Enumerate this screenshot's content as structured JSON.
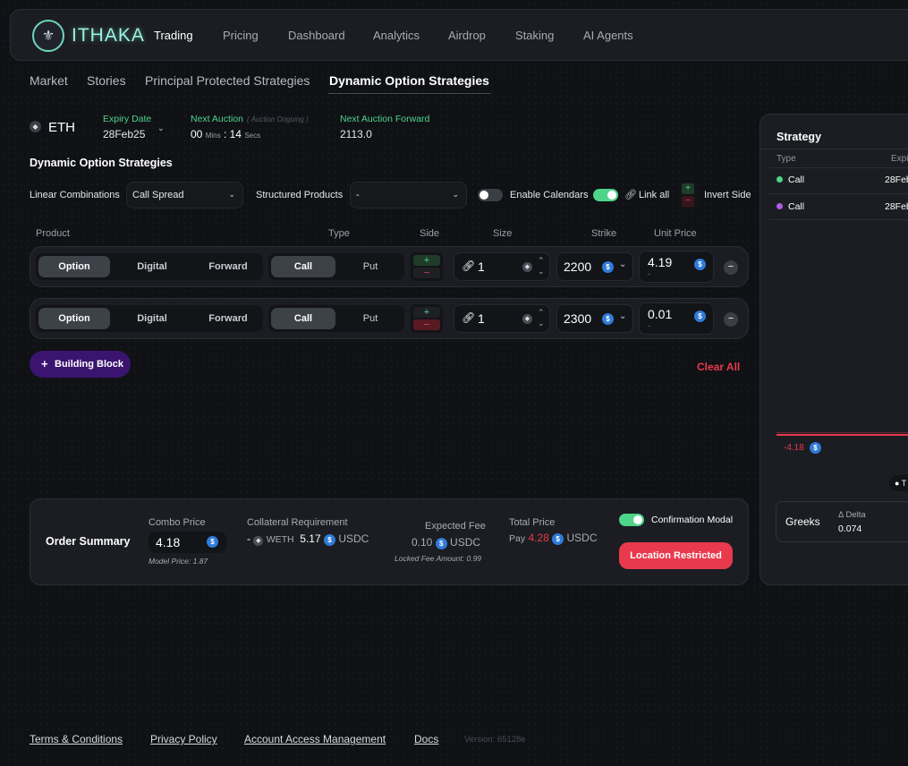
{
  "nav": {
    "logo_text": "ITHAKA",
    "items": [
      {
        "label": "Trading"
      },
      {
        "label": "Pricing"
      },
      {
        "label": "Dashboard"
      },
      {
        "label": "Analytics"
      },
      {
        "label": "Airdrop"
      },
      {
        "label": "Staking"
      },
      {
        "label": "AI Agents"
      }
    ]
  },
  "subtabs": [
    {
      "label": "Market"
    },
    {
      "label": "Stories"
    },
    {
      "label": "Principal Protected Strategies"
    },
    {
      "label": "Dynamic Option Strategies"
    }
  ],
  "asset": {
    "symbol": "ETH",
    "icon": "eth-icon"
  },
  "expiry": {
    "label": "Expiry Date",
    "value": "28Feb25"
  },
  "auction": {
    "label": "Next Auction",
    "status": "( Auction Ongoing )",
    "mins": "00",
    "mins_unit": "Mins",
    "sep": ":",
    "secs": "14",
    "secs_unit": "Secs"
  },
  "forward": {
    "label": "Next Auction Forward",
    "value": "2113.0"
  },
  "builder": {
    "title": "Dynamic Option Strategies",
    "linear_label": "Linear Combinations",
    "linear_value": "Call Spread",
    "structured_label": "Structured Products",
    "structured_value": "-",
    "enable_calendars": "Enable Calendars",
    "link_all": "Link all",
    "invert_side": "Invert Side"
  },
  "headers": {
    "product": "Product",
    "type": "Type",
    "side": "Side",
    "size": "Size",
    "strike": "Strike",
    "unit_price": "Unit Price"
  },
  "legs": [
    {
      "products": [
        "Option",
        "Digital",
        "Forward"
      ],
      "types": [
        "Call",
        "Put"
      ],
      "plus": "+",
      "minus": "−",
      "size": "1",
      "strike": "2200",
      "unit_price": "4.19",
      "sub": "-",
      "side": "buy"
    },
    {
      "products": [
        "Option",
        "Digital",
        "Forward"
      ],
      "types": [
        "Call",
        "Put"
      ],
      "plus": "+",
      "minus": "−",
      "size": "1",
      "strike": "2300",
      "unit_price": "0.01",
      "sub": "-",
      "side": "sell"
    }
  ],
  "building_block": "Building Block",
  "clear_all": "Clear All",
  "order": {
    "title": "Order Summary",
    "combo_label": "Combo Price",
    "combo_value": "4.18",
    "model_price": "Model Price: 1.87",
    "collateral_label": "Collateral Requirement",
    "collateral_dash": "-",
    "collateral_weth": "WETH",
    "collateral_value": "5.17",
    "collateral_unit": "USDC",
    "fee_label": "Expected Fee",
    "fee_value": "0.10",
    "fee_unit": "USDC",
    "locked_fee": "Locked Fee Amount: 0.99",
    "total_label": "Total Price",
    "pay_label": "Pay",
    "pay_value": "4.28",
    "pay_unit": "USDC",
    "confirm_label": "Confirmation Modal",
    "location_btn": "Location Restricted"
  },
  "strategy": {
    "title": "Strategy",
    "type_header": "Type",
    "exp_header": "Expi",
    "rows": [
      {
        "type": "Call",
        "exp": "28Feb",
        "color": "#4ed58a"
      },
      {
        "type": "Call",
        "exp": "28Feb",
        "color": "#b15be6"
      }
    ],
    "chart_label": "-4.18",
    "legend_marker": "T",
    "greeks_label": "Greeks",
    "delta_label": "Δ Delta",
    "delta_value": "0.074"
  },
  "footer": {
    "links": [
      {
        "label": "Terms & Conditions"
      },
      {
        "label": "Privacy Policy"
      },
      {
        "label": "Account Access Management"
      },
      {
        "label": "Docs"
      }
    ],
    "version": "Version: 65128e"
  },
  "colors": {
    "accent_green": "#4ed58a",
    "accent_red": "#e8394d",
    "purple": "#3b1470",
    "usdc_blue": "#2f7bd8"
  }
}
